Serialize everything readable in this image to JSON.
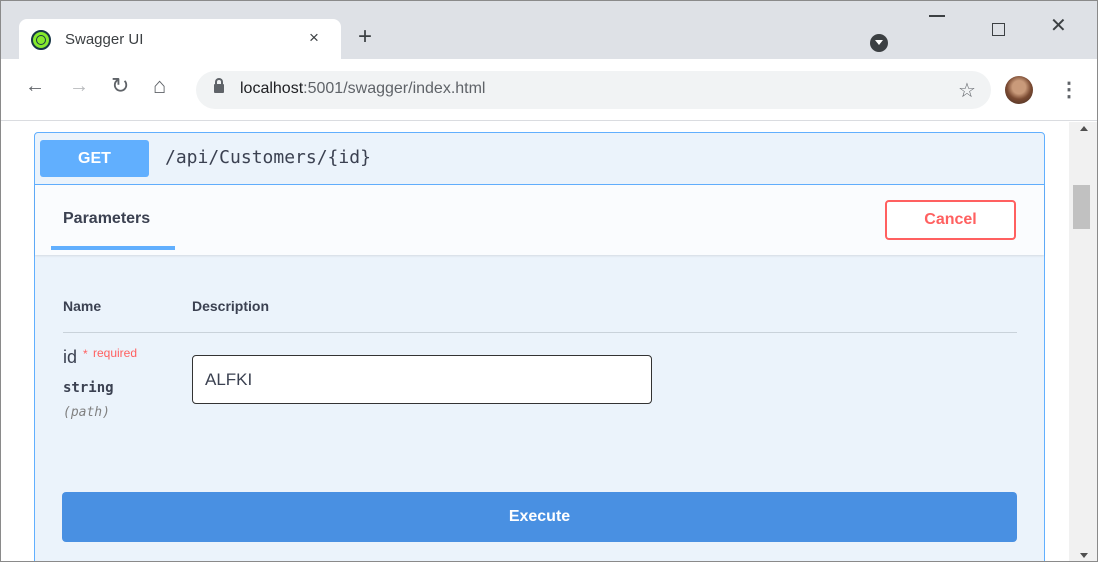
{
  "browser": {
    "tab_title": "Swagger UI",
    "tab_close": "×",
    "new_tab": "+",
    "url_host": "localhost",
    "url_rest": ":5001/swagger/index.html"
  },
  "icons": {
    "back": "arrow-left-icon",
    "forward": "arrow-right-icon",
    "reload": "reload-icon",
    "home": "home-icon",
    "lock": "lock-icon",
    "star": "star-icon",
    "menu": "kebab-menu-icon"
  },
  "operation": {
    "method": "GET",
    "path": "/api/Customers/{id}",
    "tab_label": "Parameters",
    "cancel_label": "Cancel",
    "execute_label": "Execute"
  },
  "parameters": {
    "col_name": "Name",
    "col_description": "Description",
    "items": [
      {
        "name": "id",
        "star": "*",
        "required_label": "required",
        "type": "string",
        "in": "(path)",
        "value": "ALFKI"
      }
    ]
  },
  "colors": {
    "get_accent": "#61affe",
    "execute": "#4990e2",
    "cancel": "#ff6060"
  }
}
